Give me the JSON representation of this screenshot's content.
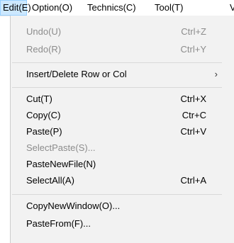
{
  "menubar": {
    "items": [
      {
        "label": "Edit(E)",
        "active": true
      },
      {
        "label": "Option(O)"
      },
      {
        "label": "Technics(C)"
      },
      {
        "label": "Tool(T)"
      },
      {
        "label": "V"
      }
    ]
  },
  "edit_menu": {
    "undo": {
      "label": "Undo(U)",
      "shortcut": "Ctrl+Z",
      "enabled": false
    },
    "redo": {
      "label": "Redo(R)",
      "shortcut": "Ctrl+Y",
      "enabled": false
    },
    "insert_delete": {
      "label": "Insert/Delete Row or Col",
      "submenu_glyph": "›"
    },
    "cut": {
      "label": "Cut(T)",
      "shortcut": "Ctrl+X"
    },
    "copy": {
      "label": "Copy(C)",
      "shortcut": "Ctr+C"
    },
    "paste": {
      "label": "Paste(P)",
      "shortcut": "Ctrl+V"
    },
    "select_paste": {
      "label": "SelectPaste(S)...",
      "enabled": false
    },
    "paste_new_file": {
      "label": "PasteNewFile(N)"
    },
    "select_all": {
      "label": "SelectAll(A)",
      "shortcut": "Ctrl+A"
    },
    "copy_new_window": {
      "label": "CopyNewWindow(O)..."
    },
    "paste_from": {
      "label": "PasteFrom(F)..."
    }
  }
}
